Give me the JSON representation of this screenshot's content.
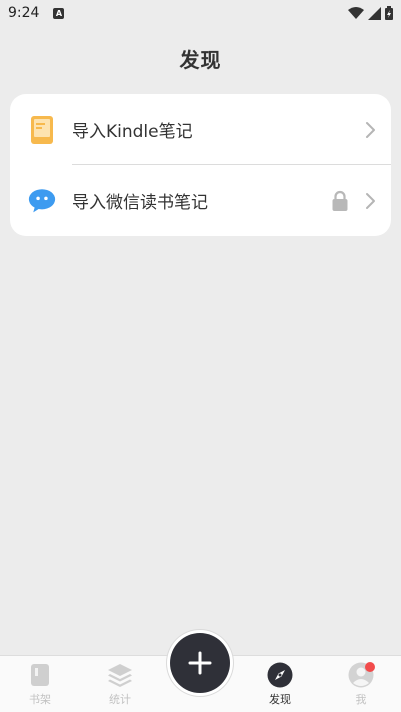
{
  "status_bar": {
    "time": "9:24",
    "notification_icon": "a-icon",
    "icons": [
      "wifi-icon",
      "signal-icon",
      "battery-icon"
    ]
  },
  "header": {
    "title": "发现"
  },
  "card": {
    "items": [
      {
        "label": "导入Kindle笔记",
        "icon": "kindle-book-icon",
        "locked": false
      },
      {
        "label": "导入微信读书笔记",
        "icon": "wechat-bubble-icon",
        "locked": true
      }
    ]
  },
  "bottom_nav": {
    "items": [
      {
        "label": "书架",
        "icon": "book-icon",
        "active": false
      },
      {
        "label": "统计",
        "icon": "layers-icon",
        "active": false
      },
      {
        "label": "发现",
        "icon": "compass-icon",
        "active": true
      },
      {
        "label": "我",
        "icon": "user-icon",
        "active": false,
        "badge": true
      }
    ],
    "fab_icon": "plus-icon"
  },
  "colors": {
    "background": "#ececec",
    "card": "#ffffff",
    "kindle_icon": "#f7b94d",
    "wechat_icon": "#3d9bf0",
    "fab": "#2f3038",
    "badge": "#f24b4b",
    "inactive_nav": "#c2c2c2",
    "active_nav": "#333333"
  }
}
